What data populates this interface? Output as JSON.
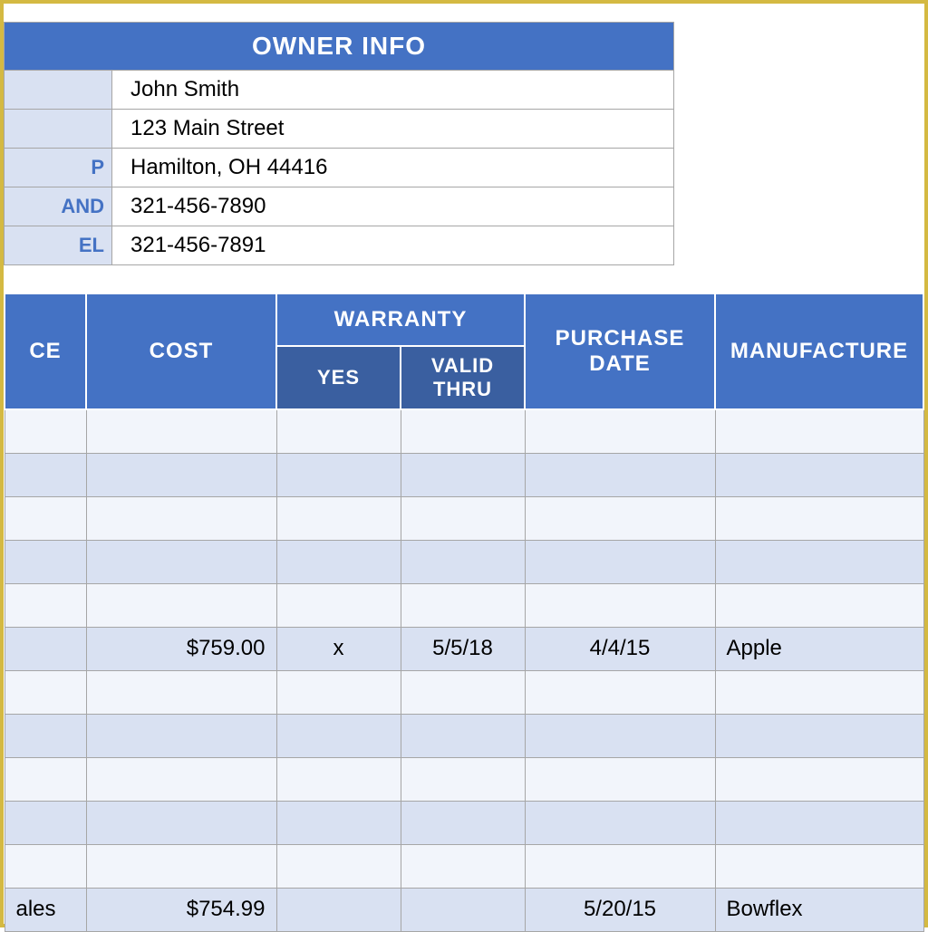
{
  "owner": {
    "header": "OWNER INFO",
    "labels": [
      "",
      "",
      "P",
      "AND",
      "EL"
    ],
    "values": [
      "John Smith",
      "123 Main Street",
      "Hamilton, OH  44416",
      "321-456-7890",
      "321-456-7891"
    ]
  },
  "table": {
    "headers": {
      "price": "CE",
      "cost": "COST",
      "warranty": "WARRANTY",
      "warranty_yes": "YES",
      "warranty_valid": "VALID THRU",
      "purchase": "PURCHASE DATE",
      "manufacturer": "MANUFACTURE"
    },
    "rows": [
      {
        "price": "",
        "cost": "",
        "yes": "",
        "valid": "",
        "purchase": "",
        "manu": ""
      },
      {
        "price": "",
        "cost": "",
        "yes": "",
        "valid": "",
        "purchase": "",
        "manu": ""
      },
      {
        "price": "",
        "cost": "",
        "yes": "",
        "valid": "",
        "purchase": "",
        "manu": ""
      },
      {
        "price": "",
        "cost": "",
        "yes": "",
        "valid": "",
        "purchase": "",
        "manu": ""
      },
      {
        "price": "",
        "cost": "",
        "yes": "",
        "valid": "",
        "purchase": "",
        "manu": ""
      },
      {
        "price": "",
        "cost": "$759.00",
        "yes": "x",
        "valid": "5/5/18",
        "purchase": "4/4/15",
        "manu": "Apple"
      },
      {
        "price": "",
        "cost": "",
        "yes": "",
        "valid": "",
        "purchase": "",
        "manu": ""
      },
      {
        "price": "",
        "cost": "",
        "yes": "",
        "valid": "",
        "purchase": "",
        "manu": ""
      },
      {
        "price": "",
        "cost": "",
        "yes": "",
        "valid": "",
        "purchase": "",
        "manu": ""
      },
      {
        "price": "",
        "cost": "",
        "yes": "",
        "valid": "",
        "purchase": "",
        "manu": ""
      },
      {
        "price": "",
        "cost": "",
        "yes": "",
        "valid": "",
        "purchase": "",
        "manu": ""
      },
      {
        "price": "ales",
        "cost": "$754.99",
        "yes": "",
        "valid": "",
        "purchase": "5/20/15",
        "manu": "Bowflex"
      }
    ]
  }
}
